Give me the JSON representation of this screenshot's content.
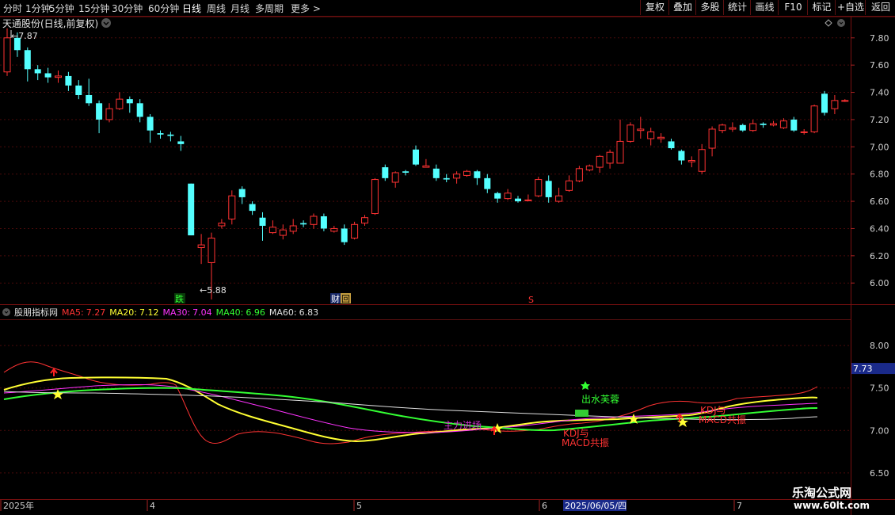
{
  "toolbar": {
    "periods": [
      "分时",
      "1分钟",
      "5分钟",
      "15分钟",
      "30分钟",
      "60分钟",
      "日线",
      "周线",
      "月线",
      "多周期",
      "更多 >"
    ],
    "active_period": "日线",
    "right_buttons": [
      "复权",
      "叠加",
      "多股",
      "统计",
      "画线",
      "F10",
      "标记",
      "+自选",
      "返回"
    ]
  },
  "main_chart": {
    "title": "天通股份(日线,前复权)",
    "high_label": "7.87",
    "low_label": "5.88",
    "price_ticks": [
      "7.80",
      "7.60",
      "7.40",
      "7.20",
      "7.00",
      "6.80",
      "6.60",
      "6.40",
      "6.20",
      "6.00"
    ],
    "event_marks": [
      "跌",
      "财",
      "回",
      "S"
    ]
  },
  "indicator": {
    "name": "股朋指标网",
    "legend": [
      {
        "label": "MA5:",
        "value": "7.27",
        "color": "#ff3333"
      },
      {
        "label": "MA20:",
        "value": "7.12",
        "color": "#ffff33"
      },
      {
        "label": "MA30:",
        "value": "7.04",
        "color": "#ff33ff"
      },
      {
        "label": "MA40:",
        "value": "6.96",
        "color": "#33ff33"
      },
      {
        "label": "MA60:",
        "value": "6.83",
        "color": "#e0e0e0"
      }
    ],
    "ticks": [
      "8.00",
      "7.50",
      "7.00",
      "6.50"
    ],
    "current_value": "7.73",
    "signals": {
      "chushui": "出水芙蓉",
      "kdj_macd_1": "KDJ与",
      "kdj_macd_2": "MACD共振",
      "left_signal": "主力进场",
      "right_signal_1": "KDJ与",
      "right_signal_2": "MACD共振"
    }
  },
  "date_axis": {
    "labels": [
      "2025年",
      "4",
      "5",
      "6",
      "7"
    ],
    "cursor_date": "2025/06/05/四"
  },
  "watermark": {
    "line1": "乐淘公式网",
    "line2": "www.60lt.com"
  },
  "chart_data": {
    "type": "candlestick",
    "y_range": [
      5.85,
      7.95
    ],
    "candles": [
      [
        7.55,
        7.8,
        7.87,
        7.52
      ],
      [
        7.8,
        7.71,
        7.84,
        7.66
      ],
      [
        7.71,
        7.57,
        7.73,
        7.48
      ],
      [
        7.57,
        7.54,
        7.6,
        7.49
      ],
      [
        7.54,
        7.51,
        7.58,
        7.47
      ],
      [
        7.51,
        7.52,
        7.56,
        7.47
      ],
      [
        7.52,
        7.45,
        7.55,
        7.41
      ],
      [
        7.45,
        7.38,
        7.49,
        7.35
      ],
      [
        7.38,
        7.32,
        7.5,
        7.3
      ],
      [
        7.32,
        7.2,
        7.34,
        7.1
      ],
      [
        7.2,
        7.28,
        7.32,
        7.18
      ],
      [
        7.28,
        7.35,
        7.4,
        7.27
      ],
      [
        7.35,
        7.32,
        7.37,
        7.25
      ],
      [
        7.32,
        7.22,
        7.35,
        7.18
      ],
      [
        7.22,
        7.12,
        7.24,
        7.03
      ],
      [
        7.1,
        7.09,
        7.12,
        7.06
      ],
      [
        7.09,
        7.08,
        7.11,
        7.04
      ],
      [
        7.04,
        7.02,
        7.08,
        6.97
      ],
      [
        6.73,
        6.35,
        6.73,
        6.35
      ],
      [
        6.26,
        6.28,
        6.36,
        6.14
      ],
      [
        6.15,
        6.33,
        6.37,
        5.88
      ],
      [
        6.42,
        6.44,
        6.47,
        6.4
      ],
      [
        6.47,
        6.64,
        6.68,
        6.43
      ],
      [
        6.69,
        6.63,
        6.71,
        6.58
      ],
      [
        6.58,
        6.53,
        6.6,
        6.5
      ],
      [
        6.48,
        6.42,
        6.52,
        6.31
      ],
      [
        6.37,
        6.41,
        6.46,
        6.36
      ],
      [
        6.35,
        6.39,
        6.43,
        6.32
      ],
      [
        6.38,
        6.42,
        6.47,
        6.36
      ],
      [
        6.44,
        6.43,
        6.46,
        6.41
      ],
      [
        6.43,
        6.49,
        6.51,
        6.4
      ],
      [
        6.49,
        6.4,
        6.51,
        6.38
      ],
      [
        6.38,
        6.4,
        6.42,
        6.37
      ],
      [
        6.4,
        6.3,
        6.43,
        6.28
      ],
      [
        6.33,
        6.43,
        6.45,
        6.32
      ],
      [
        6.44,
        6.48,
        6.5,
        6.42
      ],
      [
        6.51,
        6.76,
        6.77,
        6.5
      ],
      [
        6.85,
        6.77,
        6.87,
        6.75
      ],
      [
        6.74,
        6.81,
        6.82,
        6.7
      ],
      [
        6.82,
        6.81,
        6.83,
        6.79
      ],
      [
        6.98,
        6.87,
        7.01,
        6.86
      ],
      [
        6.85,
        6.86,
        6.91,
        6.85
      ],
      [
        6.84,
        6.77,
        6.87,
        6.75
      ],
      [
        6.77,
        6.76,
        6.8,
        6.74
      ],
      [
        6.77,
        6.8,
        6.82,
        6.73
      ],
      [
        6.79,
        6.82,
        6.83,
        6.78
      ],
      [
        6.82,
        6.77,
        6.83,
        6.72
      ],
      [
        6.77,
        6.69,
        6.8,
        6.66
      ],
      [
        6.66,
        6.62,
        6.67,
        6.59
      ],
      [
        6.62,
        6.66,
        6.69,
        6.61
      ],
      [
        6.62,
        6.6,
        6.64,
        6.59
      ],
      [
        6.61,
        6.61,
        6.65,
        6.6
      ],
      [
        6.64,
        6.76,
        6.78,
        6.63
      ],
      [
        6.75,
        6.63,
        6.79,
        6.59
      ],
      [
        6.6,
        6.64,
        6.7,
        6.59
      ],
      [
        6.68,
        6.75,
        6.79,
        6.67
      ],
      [
        6.75,
        6.84,
        6.86,
        6.74
      ],
      [
        6.83,
        6.86,
        6.87,
        6.82
      ],
      [
        6.85,
        6.93,
        6.94,
        6.81
      ],
      [
        6.88,
        6.96,
        6.98,
        6.84
      ],
      [
        6.88,
        7.04,
        7.2,
        6.88
      ],
      [
        7.04,
        7.16,
        7.18,
        7.03
      ],
      [
        7.12,
        7.13,
        7.22,
        7.06
      ],
      [
        7.06,
        7.11,
        7.14,
        7.01
      ],
      [
        7.06,
        7.07,
        7.1,
        7.03
      ],
      [
        7.04,
        6.99,
        7.06,
        6.98
      ],
      [
        6.97,
        6.9,
        6.98,
        6.87
      ],
      [
        6.89,
        6.9,
        6.93,
        6.85
      ],
      [
        6.82,
        6.98,
        7.02,
        6.8
      ],
      [
        6.99,
        7.13,
        7.15,
        6.93
      ],
      [
        7.12,
        7.16,
        7.17,
        7.1
      ],
      [
        7.13,
        7.14,
        7.18,
        7.11
      ],
      [
        7.16,
        7.12,
        7.17,
        7.11
      ],
      [
        7.12,
        7.17,
        7.2,
        7.11
      ],
      [
        7.17,
        7.16,
        7.18,
        7.14
      ],
      [
        7.16,
        7.17,
        7.19,
        7.15
      ],
      [
        7.14,
        7.19,
        7.21,
        7.13
      ],
      [
        7.2,
        7.12,
        7.22,
        7.11
      ],
      [
        7.11,
        7.11,
        7.13,
        7.09
      ],
      [
        7.11,
        7.3,
        7.31,
        7.1
      ],
      [
        7.39,
        7.25,
        7.41,
        7.23
      ],
      [
        7.28,
        7.34,
        7.38,
        7.24
      ],
      [
        7.34,
        7.34,
        7.35,
        7.33
      ]
    ]
  }
}
